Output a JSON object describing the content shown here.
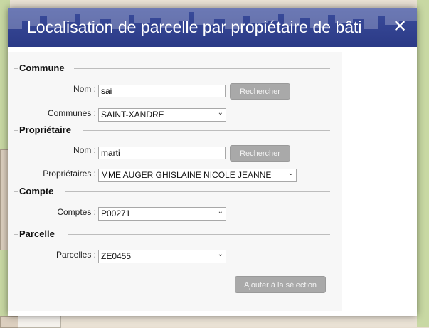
{
  "dialog": {
    "title": "Localisation de parcelle par propiétaire de bâti",
    "close_glyph": "✕"
  },
  "commune": {
    "heading": "Commune",
    "nom_label": "Nom :",
    "nom_value": "sai",
    "search_label": "Rechercher",
    "communes_label": "Communes :",
    "communes_selected": "SAINT-XANDRE"
  },
  "proprietaire": {
    "heading": "Propriétaire",
    "nom_label": "Nom :",
    "nom_value": "marti",
    "search_label": "Rechercher",
    "proprietaires_label": "Propriétaires :",
    "proprietaires_selected": "MME AUGER GHISLAINE NICOLE JEANNE"
  },
  "compte": {
    "heading": "Compte",
    "comptes_label": "Comptes :",
    "comptes_selected": "P00271"
  },
  "parcelle": {
    "heading": "Parcelle",
    "parcelles_label": "Parcelles :",
    "parcelles_selected": "ZE0455"
  },
  "actions": {
    "add_label": "Ajouter à la sélection"
  },
  "icons": {
    "close": "close-icon",
    "dropdown": "chevron-down-icon"
  },
  "colors": {
    "titlebar": "#2f3f8c",
    "button": "#a9a9a9"
  }
}
